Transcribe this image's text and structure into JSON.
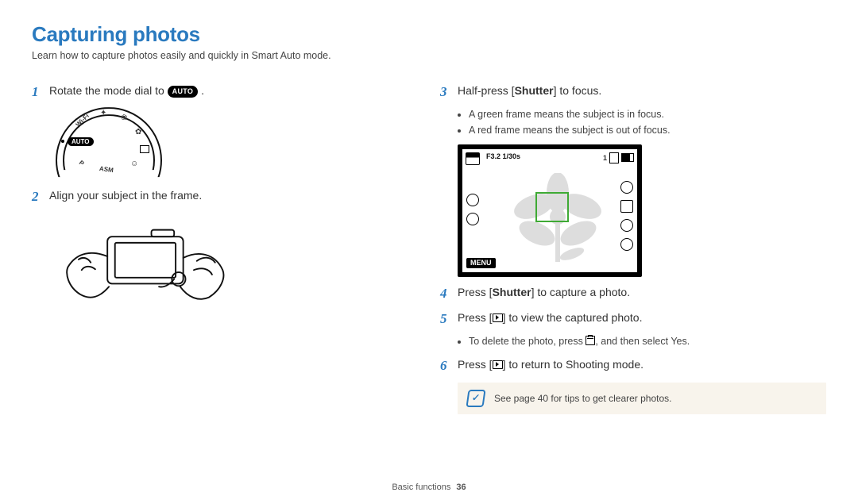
{
  "header": {
    "title": "Capturing photos",
    "subtitle": "Learn how to capture photos easily and quickly in Smart Auto mode."
  },
  "left": {
    "step1_pre": "Rotate the mode dial to ",
    "step1_badge": "AUTO",
    "step1_post": " .",
    "dial_labels": {
      "wifi": "Wi-Fi",
      "asm": "ASM",
      "p": "P",
      "auto": "AUTO"
    },
    "step2": "Align your subject in the frame."
  },
  "right": {
    "step3_pre": "Half-press [",
    "step3_bold": "Shutter",
    "step3_post": "] to focus.",
    "step3_bullets": [
      "A green frame means the subject is in focus.",
      "A red frame means the subject is out of focus."
    ],
    "lcd": {
      "info": "F3.2 1/30s",
      "count": "1",
      "menu": "MENU"
    },
    "step4_pre": "Press [",
    "step4_bold": "Shutter",
    "step4_post": "] to capture a photo.",
    "step5_pre": "Press [",
    "step5_post": "] to view the captured photo.",
    "step5_bullet_pre": "To delete the photo, press ",
    "step5_bullet_mid": ", and then select ",
    "step5_bullet_bold": "Yes",
    "step5_bullet_post": ".",
    "step6_pre": "Press [",
    "step6_post": "] to return to Shooting mode.",
    "tip": "See page 40 for tips to get clearer photos."
  },
  "footer": {
    "section": "Basic functions",
    "page": "36"
  }
}
